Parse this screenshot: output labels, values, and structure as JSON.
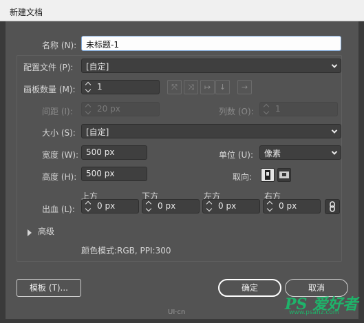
{
  "window": {
    "title": "新建文档"
  },
  "fields": {
    "name_label": "名称 (N):",
    "name_value": "未标题-1",
    "profile_label": "配置文件 (P):",
    "profile_value": "[自定]",
    "artboard_count_label": "画板数量 (M):",
    "artboard_count_value": "1",
    "spacing_label": "间距 (I):",
    "spacing_value": "20 px",
    "columns_label": "列数 (O):",
    "columns_value": "1",
    "size_label": "大小 (S):",
    "size_value": "[自定]",
    "width_label": "宽度 (W):",
    "width_value": "500 px",
    "units_label": "单位 (U):",
    "units_value": "像素",
    "height_label": "高度 (H):",
    "height_value": "500 px",
    "orientation_label": "取向:",
    "bleed_label": "出血 (L):",
    "bleed_top_label": "上方",
    "bleed_bottom_label": "下方",
    "bleed_left_label": "左方",
    "bleed_right_label": "右方",
    "bleed_top_value": "0 px",
    "bleed_bottom_value": "0 px",
    "bleed_left_value": "0 px",
    "bleed_right_value": "0 px"
  },
  "advanced": {
    "label": "高级",
    "color_mode_text": "颜色模式:RGB, PPI:300"
  },
  "buttons": {
    "templates": "模板 (T)...",
    "ok": "确定",
    "cancel": "取消"
  },
  "watermark": {
    "brand": "PS 爱好者",
    "url": "www.psahz.com",
    "logo": "UI·cn"
  }
}
